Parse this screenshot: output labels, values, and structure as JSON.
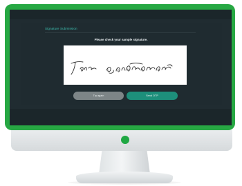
{
  "panel": {
    "title": "Signature Submission",
    "instruction": "Please check your sample signature."
  },
  "buttons": {
    "try_again": "Try again",
    "send_otp": "Send OTP"
  },
  "colors": {
    "bezel": "#27a843",
    "screen": "#202c31",
    "accent_title": "#3ec3b4",
    "send_button": "#1d8f7b",
    "try_button": "#7d8587",
    "power_led": "#1fa843"
  },
  "icons": {
    "power": "power-indicator-icon",
    "signature": "handwritten-signature"
  }
}
